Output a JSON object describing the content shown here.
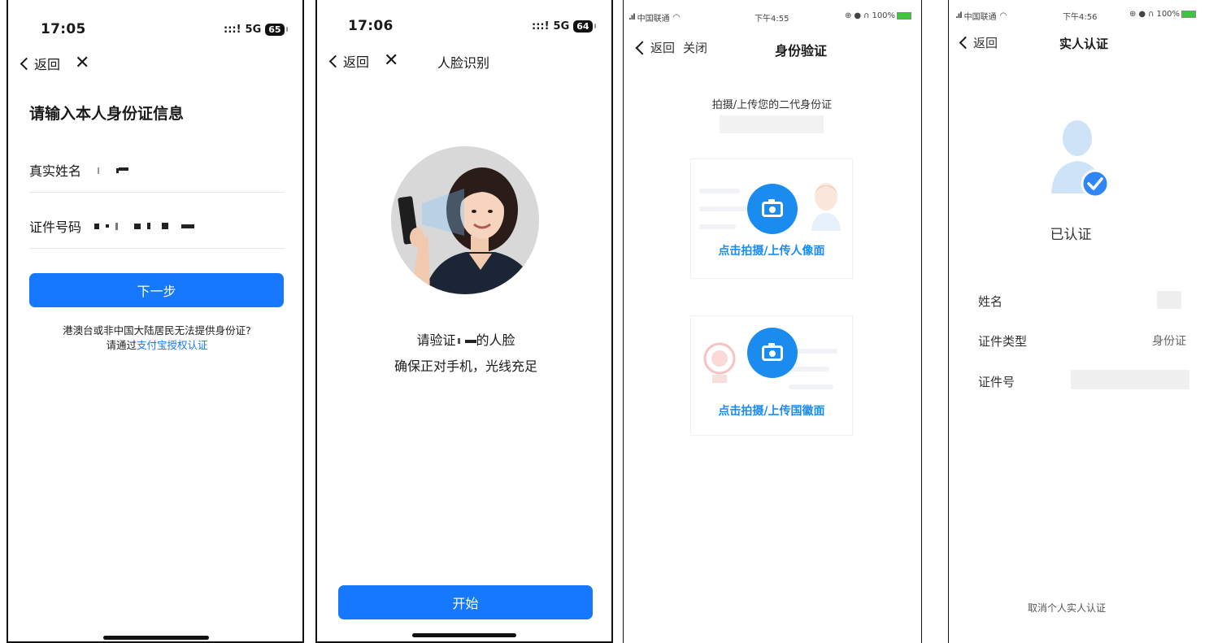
{
  "colors": {
    "accent": "#1677ff",
    "upload_blue": "#1a8cf0",
    "verified_blue": "#2f86f6",
    "avatar_light": "#cfe3f8"
  },
  "screen1": {
    "time": "17:05",
    "network": "5G",
    "battery": "65",
    "back_label": "返回",
    "heading": "请输入本人身份证信息",
    "name_label": "真实姓名",
    "id_label": "证件号码",
    "next_button": "下一步",
    "note_line1": "港澳台或非中国大陆居民无法提供身份证?",
    "note_line2_prefix": "请通过",
    "note_link": "支付宝授权认证"
  },
  "screen2": {
    "time": "17:06",
    "network": "5G",
    "battery": "64",
    "back_label": "返回",
    "title": "人脸识别",
    "line1_prefix": "请验证",
    "line1_suffix": "的人脸",
    "line2": "确保正对手机，光线充足",
    "start_button": "开始"
  },
  "screen3": {
    "carrier": "中国联通",
    "time": "下午4:55",
    "battery": "100%",
    "back_label": "返回",
    "close_label": "关闭",
    "title": "身份验证",
    "instruction": "拍摄/上传您的二代身份证",
    "portrait_caption": "点击拍摄/上传人像面",
    "emblem_caption": "点击拍摄/上传国徽面"
  },
  "screen4": {
    "carrier": "中国联通",
    "time": "下午4:56",
    "battery": "100%",
    "back_label": "返回",
    "title": "实人认证",
    "status": "已认证",
    "name_label": "姓名",
    "type_label": "证件类型",
    "type_value": "身份证",
    "number_label": "证件号",
    "cancel_link": "取消个人实人认证"
  }
}
